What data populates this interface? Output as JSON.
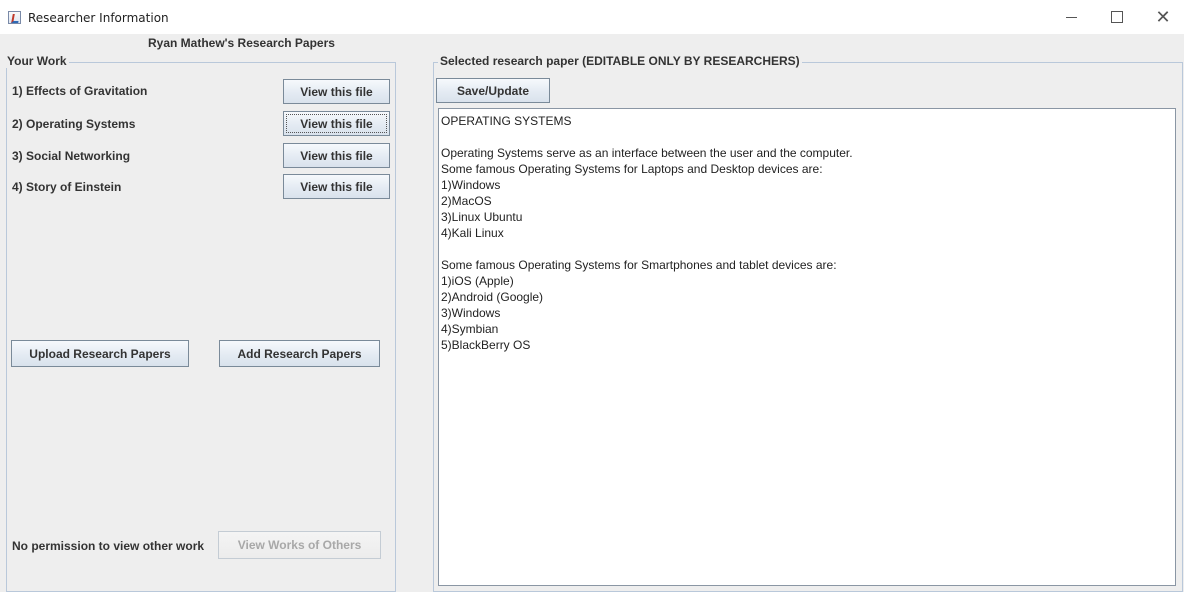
{
  "window": {
    "title": "Researcher Information",
    "controls": {
      "minimize": "minimize",
      "maximize": "maximize",
      "close": "close"
    }
  },
  "header": {
    "owner_heading": "Ryan Mathew's Research Papers"
  },
  "your_work": {
    "legend": "Your Work",
    "papers": [
      {
        "label": "1) Effects of Gravitation",
        "button": "View this file"
      },
      {
        "label": "2) Operating Systems",
        "button": "View this file"
      },
      {
        "label": "3) Social Networking",
        "button": "View this file"
      },
      {
        "label": "4) Story of Einstein",
        "button": "View this file"
      }
    ],
    "upload_button": "Upload Research Papers",
    "add_button": "Add Research Papers",
    "no_permission_text": "No permission to view other work",
    "view_others_button": "View Works of Others"
  },
  "selected_paper": {
    "legend": "Selected research paper (EDITABLE ONLY BY RESEARCHERS)",
    "save_button": "Save/Update",
    "content": "OPERATING SYSTEMS\n\nOperating Systems serve as an interface between the user and the computer.\nSome famous Operating Systems for Laptops and Desktop devices are:\n1)Windows\n2)MacOS\n3)Linux Ubuntu\n4)Kali Linux\n\nSome famous Operating Systems for Smartphones and tablet devices are:\n1)iOS (Apple)\n2)Android (Google)\n3)Windows\n4)Symbian\n5)BlackBerry OS"
  }
}
